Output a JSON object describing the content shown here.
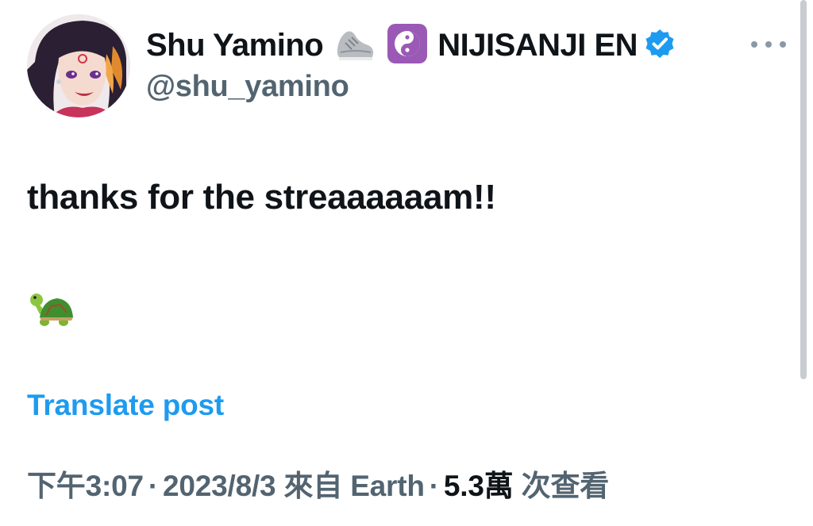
{
  "author": {
    "display_name": "Shu Yamino",
    "org_name": "NIJISANJI EN",
    "handle": "@shu_yamino",
    "name_emojis": [
      "sneaker-emoji",
      "yin-yang-emoji"
    ],
    "verified": true
  },
  "post": {
    "text": "thanks for the streaaaaaam!!",
    "emoji_line": "turtle-emoji"
  },
  "actions": {
    "translate_label": "Translate post"
  },
  "meta": {
    "time": "下午3:07",
    "separator": "·",
    "date": "2023/8/3",
    "source": "來自 Earth",
    "views_count": "5.3萬",
    "views_label": "次查看"
  },
  "colors": {
    "text_primary": "#0f1419",
    "text_secondary": "#536471",
    "accent_blue": "#1d9bf0",
    "verified_badge": "#1d9bf0",
    "yin_yang_bg": "#9b59b6"
  }
}
